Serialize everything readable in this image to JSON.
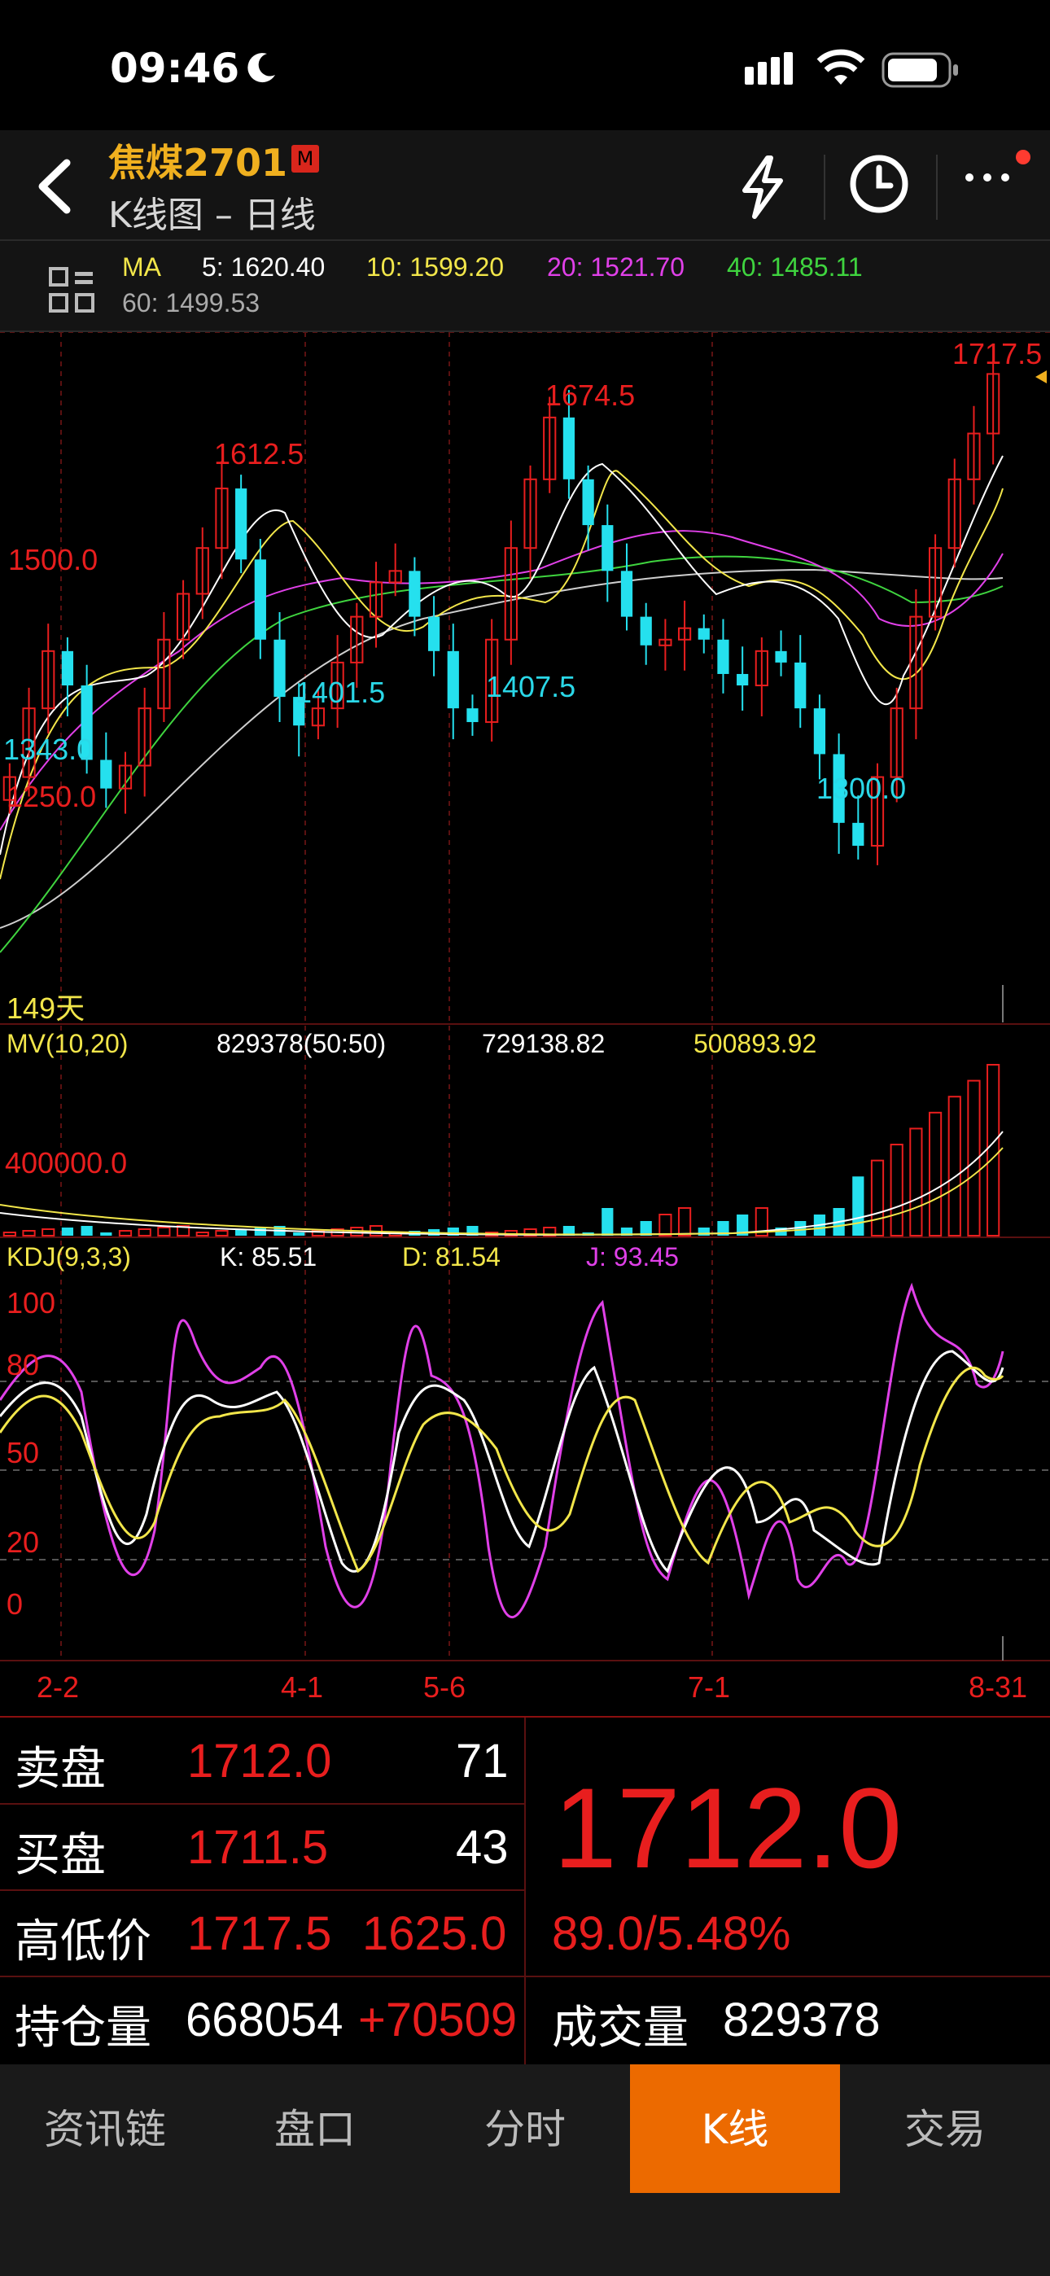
{
  "status": {
    "time": "09:46"
  },
  "header": {
    "title": "焦煤2701",
    "badge": "M",
    "subtitle": "K线图 – 日线"
  },
  "ma": {
    "label": "MA",
    "ma5": "5: 1620.40",
    "ma10": "10: 1599.20",
    "ma20": "20: 1521.70",
    "ma40": "40: 1485.11",
    "ma60": "60: 1499.53",
    "colors": {
      "ma5": "#ffffff",
      "ma10": "#f2e64a",
      "ma20": "#e040e8",
      "ma40": "#3fd43f",
      "ma60": "#cfcfcf"
    }
  },
  "price_chart": {
    "labels": {
      "high_right": "1717.5",
      "peak1": "1612.5",
      "peak2": "1674.5",
      "level1500": "1500.0",
      "low1": "1401.5",
      "low2": "1407.5",
      "low_left": "1343.0",
      "level1250": "1250.0",
      "low_right": "1300.0",
      "days": "149天"
    }
  },
  "mv": {
    "title": "MV(10,20)",
    "v1": "829378(50:50)",
    "v2": "729138.82",
    "v3": "500893.92",
    "level": "400000.0"
  },
  "kdj": {
    "title": "KDJ(9,3,3)",
    "k": "K: 85.51",
    "d": "D: 81.54",
    "j": "J: 93.45",
    "levels": [
      "100",
      "80",
      "50",
      "20",
      "0"
    ]
  },
  "dates": [
    "2-2",
    "4-1",
    "5-6",
    "7-1",
    "8-31"
  ],
  "quote": {
    "sell_label": "卖盘",
    "sell_price": "1712.0",
    "sell_qty": "71",
    "buy_label": "买盘",
    "buy_price": "1711.5",
    "buy_qty": "43",
    "hl_label": "高低价",
    "high": "1717.5",
    "low": "1625.0",
    "oi_label": "持仓量",
    "oi": "668054",
    "oi_change": "+70509",
    "last": "1712.0",
    "change": "89.0/5.48%",
    "vol_label": "成交量",
    "volume": "829378"
  },
  "tabs": [
    "资讯链",
    "盘口",
    "分时",
    "K线",
    "交易"
  ],
  "active_tab": "K线",
  "chart_data": {
    "type": "candlestick",
    "instrument": "焦煤2701",
    "period": "日线",
    "x_ticks": [
      "2-2",
      "4-1",
      "5-6",
      "7-1",
      "8-31"
    ],
    "marked_prices": {
      "high": 1717.5,
      "peak1": 1612.5,
      "peak2": 1674.5,
      "trough1": 1401.5,
      "trough2": 1407.5,
      "trough3": 1300.0,
      "left_low": 1343.0
    },
    "price_levels": [
      1500.0,
      1250.0
    ],
    "ma_values": {
      "ma5": 1620.4,
      "ma10": 1599.2,
      "ma20": 1521.7,
      "ma40": 1485.11,
      "ma60": 1499.53
    },
    "close_path": [
      1360,
      1420,
      1470,
      1440,
      1375,
      1350,
      1370,
      1420,
      1480,
      1520,
      1560,
      1612,
      1550,
      1480,
      1430,
      1405,
      1420,
      1460,
      1500,
      1530,
      1540,
      1500,
      1470,
      1420,
      1408,
      1480,
      1560,
      1620,
      1674,
      1620,
      1580,
      1540,
      1500,
      1475,
      1480,
      1490,
      1480,
      1450,
      1440,
      1470,
      1460,
      1420,
      1380,
      1320,
      1300,
      1360,
      1420,
      1500,
      1560,
      1620,
      1660,
      1712
    ],
    "volume_levels": [
      400000.0
    ],
    "kdj_levels": [
      0,
      20,
      50,
      80,
      100
    ],
    "kdj_last": {
      "K": 85.51,
      "D": 81.54,
      "J": 93.45
    }
  }
}
